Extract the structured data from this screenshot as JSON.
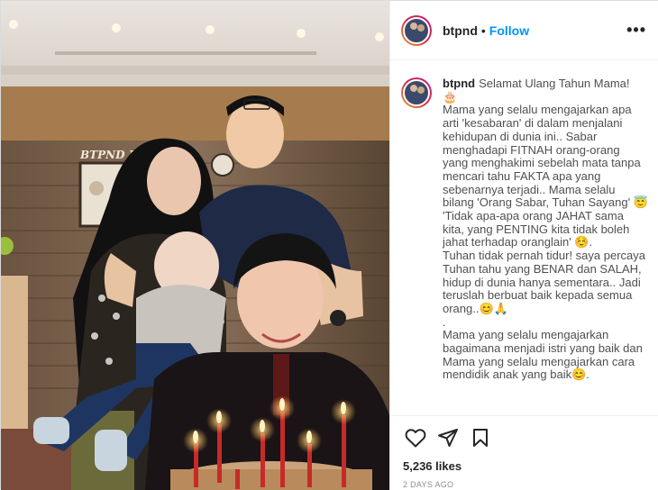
{
  "post": {
    "username": "btpnd",
    "separator": "•",
    "follow_label": "Follow",
    "more_label": "•••",
    "photo_sign_text": "BTPND Jam",
    "caption_username": "btpnd",
    "caption_text": "Selamat Ulang Tahun Mama!\n🎂\nMama yang selalu mengajarkan apa arti 'kesabaran' di dalam menjalani kehidupan di dunia ini.. Sabar menghadapi FITNAH orang-orang yang menghakimi sebelah mata tanpa mencari tahu FAKTA apa yang sebenarnya terjadi.. Mama selalu bilang 'Orang Sabar, Tuhan Sayang' 😇 'Tidak apa-apa orang JAHAT sama kita, yang PENTING kita tidak boleh jahat terhadap oranglain' ☺️.\nTuhan tidak pernah tidur! saya percaya Tuhan tahu yang BENAR dan SALAH, hidup di dunia hanya sementara.. Jadi teruslah berbuat baik kepada semua orang..😊🙏\n.\nMama yang selalu mengajarkan bagaimana menjadi istri yang baik dan Mama yang selalu mengajarkan cara mendidik anak yang baik😊.",
    "likes": "5,236 likes",
    "time_ago": "2 DAYS AGO"
  },
  "icons": {
    "like": "heart-icon",
    "share": "paper-plane-icon",
    "save": "bookmark-icon"
  },
  "colors": {
    "follow": "#0095f6",
    "text": "#262626",
    "muted": "#8e8e8e"
  }
}
